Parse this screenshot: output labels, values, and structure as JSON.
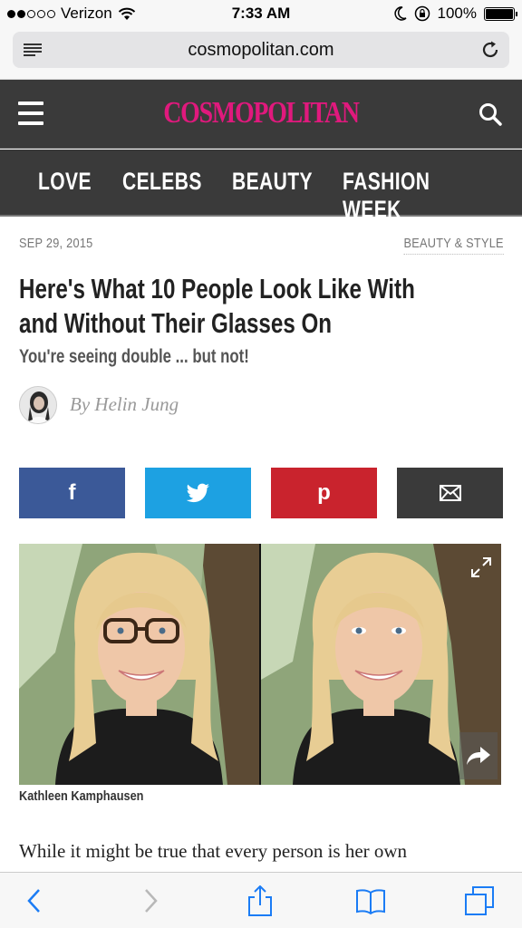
{
  "status_bar": {
    "carrier": "Verizon",
    "time": "7:33 AM",
    "battery": "100%"
  },
  "browser": {
    "url": "cosmopolitan.com"
  },
  "site": {
    "logo": "COSMOPOLITAN",
    "nav": [
      "LOVE",
      "CELEBS",
      "BEAUTY",
      "FASHION WEEK"
    ]
  },
  "article": {
    "date": "SEP 29, 2015",
    "category": "BEAUTY & STYLE",
    "headline": "Here's What 10 People Look Like With and Without Their Glasses On",
    "dek": "You're seeing double ... but not!",
    "byline": "By Helin Jung",
    "caption": "Kathleen Kamphausen",
    "body": "While it might be true that every person is her own"
  },
  "share": {
    "facebook": "f",
    "twitter": "twitter-icon",
    "pinterest": "p",
    "email": "mail-icon"
  },
  "colors": {
    "brand": "#e0197d",
    "header_bg": "#3a3a3a",
    "facebook": "#3b5998",
    "twitter": "#1da1e2",
    "pinterest": "#c9232d",
    "ios_blue": "#1b7cf5"
  }
}
